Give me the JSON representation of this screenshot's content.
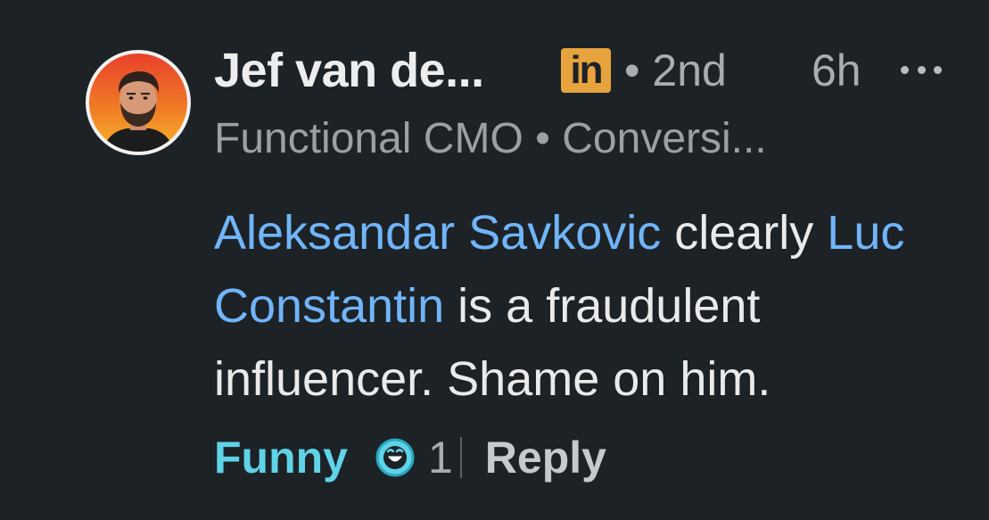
{
  "comment": {
    "author": {
      "name": "Jef van de...",
      "badge": "in",
      "degree": "• 2nd",
      "headline": "Functional CMO • Conversi..."
    },
    "time": "6h",
    "more_icon": "ellipsis-icon",
    "body": {
      "mention_1": "Aleksandar Savkovic",
      "text_1": " clearly ",
      "mention_2": "Luc Constantin",
      "text_2": " is a fraudulent influencer. Shame on him."
    },
    "actions": {
      "reaction_label": "Funny",
      "reaction_icon": "funny-emoji-icon",
      "reaction_count": "1",
      "reply_label": "Reply"
    }
  },
  "colors": {
    "background": "#1d2226",
    "mention": "#70b5f9",
    "funny_reaction": "#5fd3e8",
    "linkedin_badge": "#e7a33e"
  }
}
